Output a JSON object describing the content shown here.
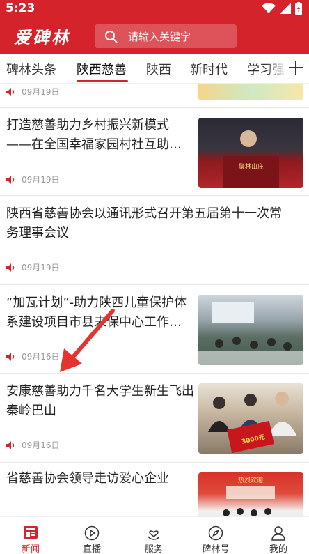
{
  "status": {
    "time": "5:23"
  },
  "header": {
    "logo": "爱碑林",
    "search_placeholder": "请输入关键字"
  },
  "tabs": [
    {
      "label": "碑林头条"
    },
    {
      "label": "陕西慈善"
    },
    {
      "label": "陕西"
    },
    {
      "label": "新时代"
    },
    {
      "label": "学习强"
    }
  ],
  "active_tab": "陕西慈善",
  "articles": [
    {
      "title_lines": [],
      "date": "09月19日"
    },
    {
      "title_lines": [
        "打造慈善助力乡村振兴新模式",
        "——在全国幸福家园村社互助…"
      ],
      "date": "09月19日",
      "thumb_text": "聚林山庄"
    },
    {
      "title_lines": [
        "陕西省慈善协会以通讯形式召开第五届第十一次常",
        "务理事会议"
      ],
      "date": "09月19日"
    },
    {
      "title_lines": [
        "“加瓦计划”-助力陕西儿童保护体",
        "系建设项目市县未保中心工作…"
      ],
      "date": "09月16日"
    },
    {
      "title_lines": [
        "安康慈善助力千名大学生新生飞出",
        "秦岭巴山"
      ],
      "date": "09月16日",
      "thumb_text": "3000元"
    },
    {
      "title_lines": [
        "省慈善协会领导走访爱心企业"
      ],
      "thumb_text": "热烈欢迎"
    }
  ],
  "bottom_nav": [
    {
      "label": "新闻",
      "icon": "news-icon"
    },
    {
      "label": "直播",
      "icon": "play-icon"
    },
    {
      "label": "服务",
      "icon": "heart-hand-icon"
    },
    {
      "label": "碑林号",
      "icon": "compass-icon"
    },
    {
      "label": "我的",
      "icon": "user-icon"
    }
  ],
  "colors": {
    "brand": "#d5232b"
  }
}
